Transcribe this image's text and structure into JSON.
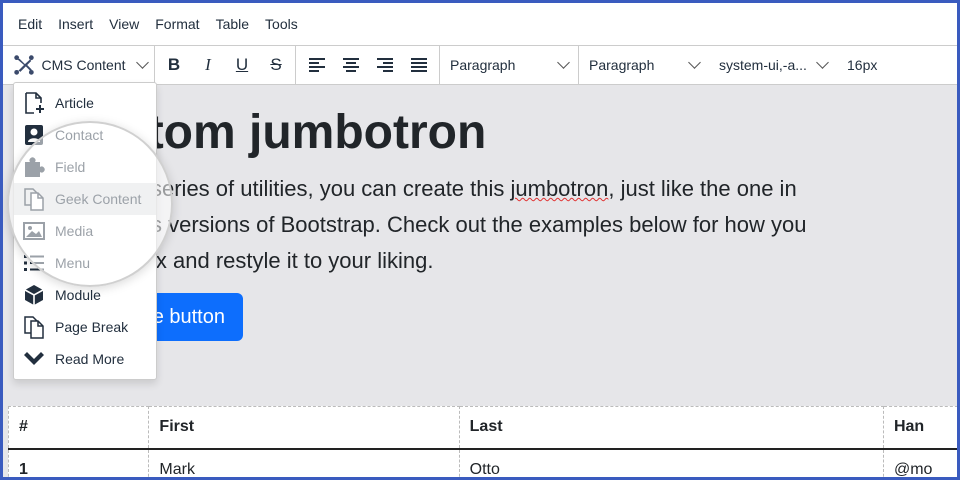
{
  "menubar": {
    "items": [
      "Edit",
      "Insert",
      "View",
      "Format",
      "Table",
      "Tools"
    ]
  },
  "toolbar": {
    "cms_label": "CMS Content",
    "bold": "B",
    "italic": "I",
    "underline": "U",
    "strike": "S",
    "block_format_1": "Paragraph",
    "block_format_2": "Paragraph",
    "font_family": "system-ui,-a...",
    "font_size": "16px"
  },
  "dropdown": {
    "items": [
      {
        "label": "Article",
        "icon": "article-add-icon"
      },
      {
        "label": "Contact",
        "icon": "contact-icon"
      },
      {
        "label": "Field",
        "icon": "puzzle-icon"
      },
      {
        "label": "Geek Content",
        "icon": "copy-icon",
        "active": true
      },
      {
        "label": "Media",
        "icon": "image-icon"
      },
      {
        "label": "Menu",
        "icon": "list-icon"
      },
      {
        "label": "Module",
        "icon": "cube-icon"
      },
      {
        "label": "Page Break",
        "icon": "copy-icon"
      },
      {
        "label": "Read More",
        "icon": "chevron-down-icon"
      }
    ]
  },
  "jumbotron": {
    "title": "stom jumbotron",
    "line1": "series of utilities, you can create this ",
    "line1_misspelled": "jumbotron",
    "line1_end": ", just like the one in",
    "line2": "s versions of Bootstrap. Check out the examples below for how you",
    "line3": "ix and restyle it to your liking.",
    "button": "e button"
  },
  "table": {
    "headers": [
      "#",
      "First",
      "Last",
      "Han"
    ],
    "rows": [
      [
        "1",
        "Mark",
        "Otto",
        "@mo"
      ]
    ]
  },
  "colors": {
    "frame_border": "#3a5bbf",
    "button_blue": "#0d6efd",
    "content_bg": "#e6e6e9"
  }
}
